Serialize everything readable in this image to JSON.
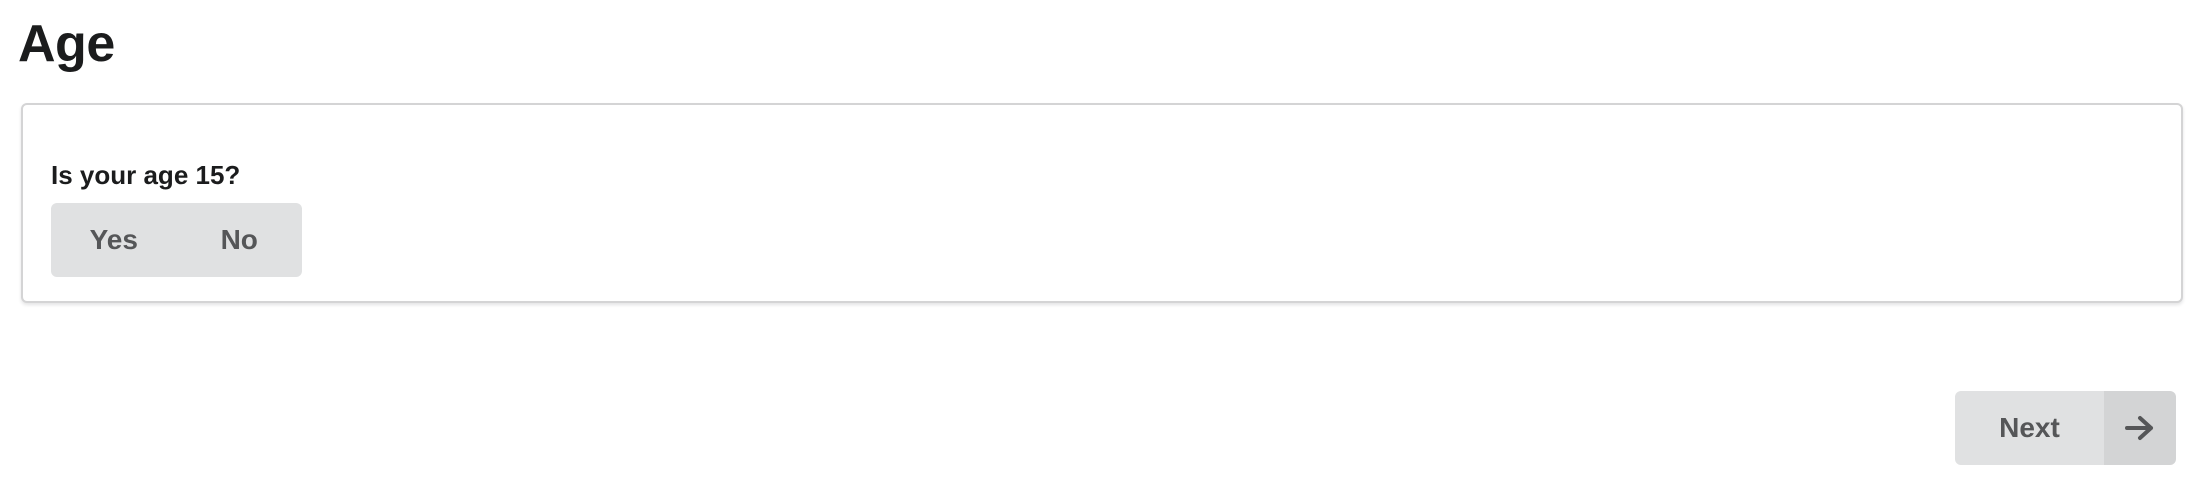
{
  "page": {
    "title": "Age"
  },
  "question": {
    "label": "Is your age 15?",
    "options": [
      {
        "label": "Yes"
      },
      {
        "label": "No"
      }
    ]
  },
  "footer": {
    "next_label": "Next",
    "next_icon": "arrow-right-icon"
  },
  "colors": {
    "button_bg": "#e0e1e2",
    "button_icon_bg": "#d3d4d5",
    "button_text": "#555658",
    "card_border": "#d4d4d5"
  }
}
